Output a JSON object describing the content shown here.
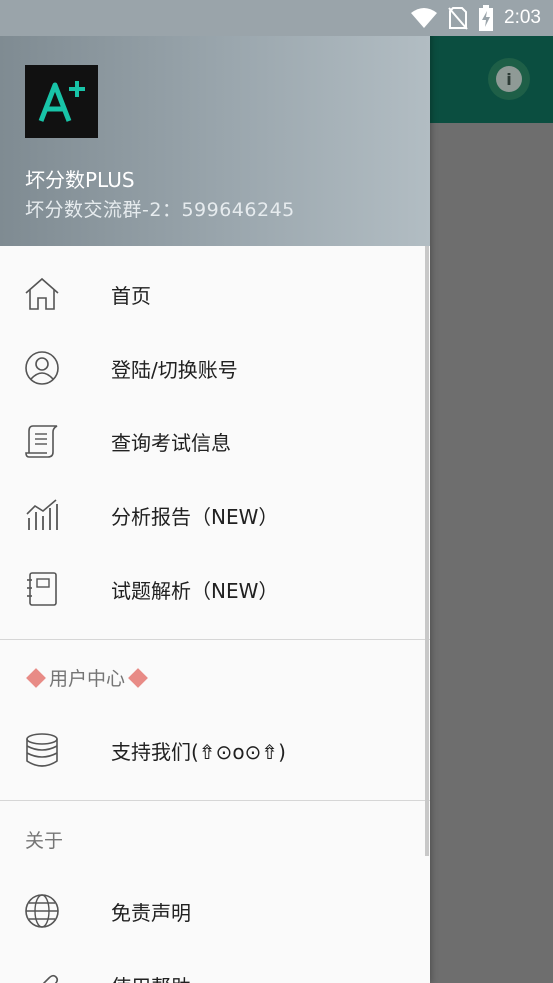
{
  "status_bar": {
    "time": "2:03"
  },
  "header": {
    "title": "坏分数PLUS",
    "subtitle": "坏分数交流群-2：599646245",
    "logo_text": "A"
  },
  "menu": [
    {
      "label": "首页",
      "icon": "home-icon"
    },
    {
      "label": "登陆/切换账号",
      "icon": "account-icon"
    },
    {
      "label": "查询考试信息",
      "icon": "scroll-icon"
    },
    {
      "label": "分析报告（NEW）",
      "icon": "chart-icon"
    },
    {
      "label": "试题解析（NEW）",
      "icon": "notebook-icon"
    }
  ],
  "user_center": {
    "title": "用户中心",
    "items": [
      {
        "label": "支持我们(⇮⊙o⊙⇮)",
        "icon": "database-icon"
      }
    ]
  },
  "about": {
    "title": "关于",
    "items": [
      {
        "label": "免责声明",
        "icon": "globe-icon"
      },
      {
        "label": "使用帮助",
        "icon": "help-icon"
      }
    ]
  },
  "colors": {
    "toolbar": "#0b4e40",
    "accent_diamond": "#e88b86",
    "logo_accent": "#18c4a8"
  }
}
